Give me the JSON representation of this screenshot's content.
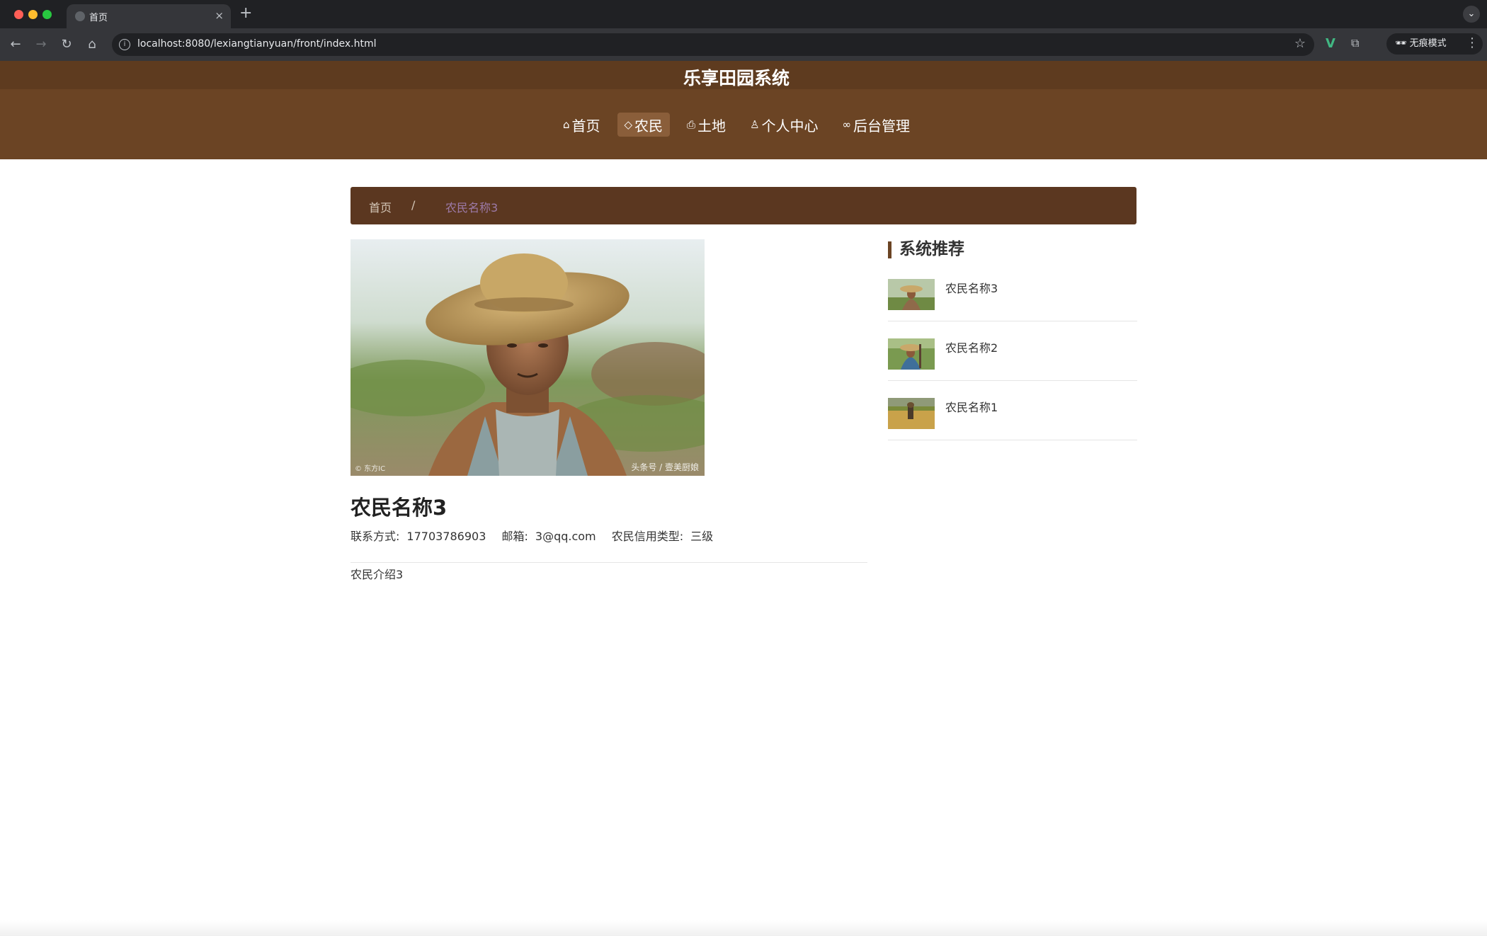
{
  "browser": {
    "tab_title": "首页",
    "tab_close": "×",
    "new_tab": "+",
    "url": "localhost:8080/lexiangtianyuan/front/index.html",
    "incognito_label": "无痕模式"
  },
  "site": {
    "title": "乐享田园系统",
    "nav": [
      {
        "label": "首页",
        "icon": "home-icon",
        "active": false
      },
      {
        "label": "农民",
        "icon": "tag-icon",
        "active": true
      },
      {
        "label": "土地",
        "icon": "printer-icon",
        "active": false
      },
      {
        "label": "个人中心",
        "icon": "user-icon",
        "active": false
      },
      {
        "label": "后台管理",
        "icon": "link-icon",
        "active": false
      }
    ]
  },
  "breadcrumb": {
    "home": "首页",
    "separator": "/",
    "current": "农民名称3"
  },
  "detail": {
    "photo_watermark_left": "© 东方IC",
    "photo_watermark_right": "头条号 / 壹美厨娘",
    "title": "农民名称3",
    "contact_label": "联系方式:",
    "contact_value": "17703786903",
    "email_label": "邮箱:",
    "email_value": "3@qq.com",
    "credit_label": "农民信用类型:",
    "credit_value": "三级",
    "intro": "农民介绍3"
  },
  "sidebar": {
    "title": "系统推荐",
    "items": [
      {
        "name": "农民名称3"
      },
      {
        "name": "农民名称2"
      },
      {
        "name": "农民名称1"
      }
    ]
  },
  "colors": {
    "header_brown": "#6b4424",
    "breadcrumb_brown": "#5b3720",
    "crumb_current": "#9d7aa8"
  }
}
